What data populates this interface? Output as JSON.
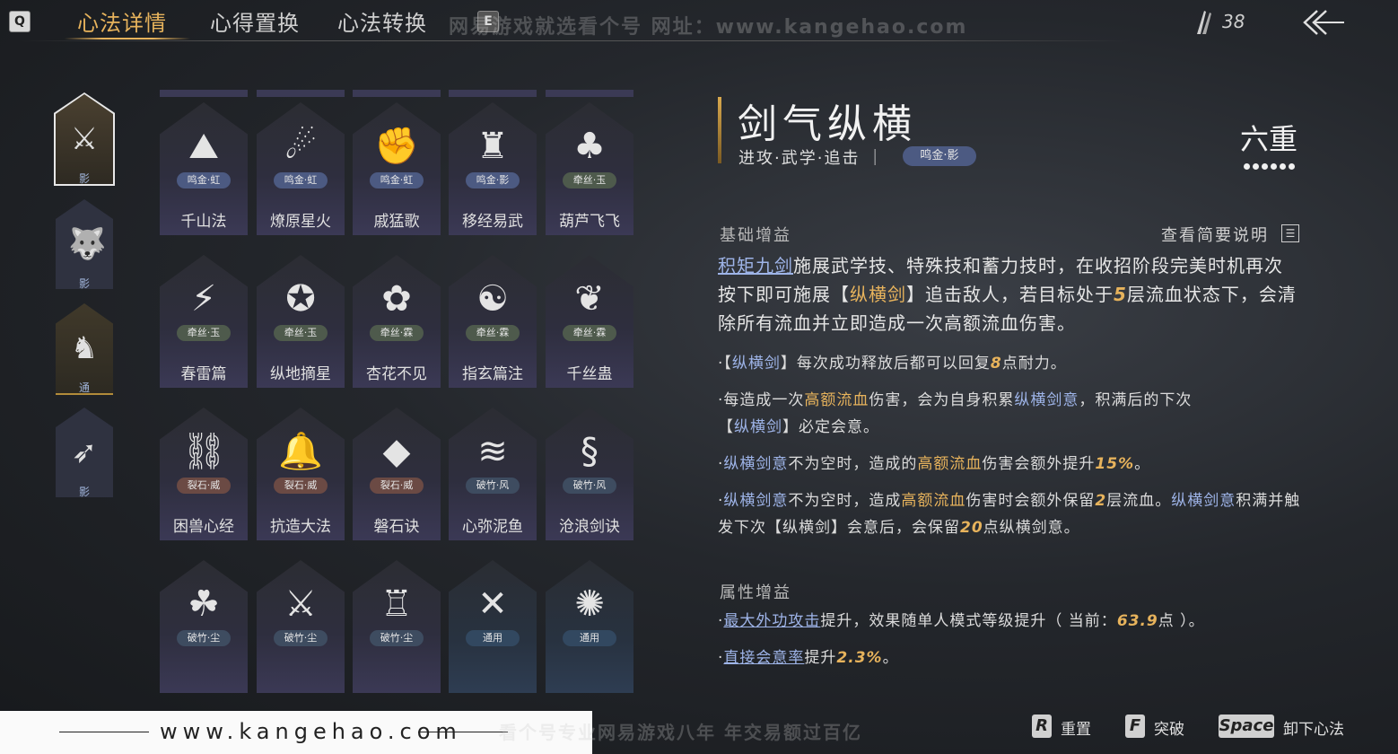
{
  "top": {
    "q_key": "Q",
    "tabs": [
      "心法详情",
      "心得置换",
      "心法转换"
    ],
    "e_key": "E",
    "watermark": "网易游戏就选看个号  网址：www.kangehao.com",
    "resource_count": "38",
    "icons": [
      "feather-icon",
      "back-arrow-icon"
    ]
  },
  "side_tabs": [
    {
      "icon": "sword-slash-icon",
      "label": "影"
    },
    {
      "icon": "wolf-icon",
      "label": "影"
    },
    {
      "icon": "horse-icon",
      "label": "通"
    },
    {
      "icon": "bow-icon",
      "label": "影"
    }
  ],
  "cards": [
    {
      "name": "千山法",
      "badge": "鸣金·虹",
      "kind": "jin",
      "icon": "mountain-icon",
      "glyph": "⛰"
    },
    {
      "name": "燎原星火",
      "badge": "鸣金·虹",
      "kind": "jin",
      "icon": "scythe-icon",
      "glyph": "☄"
    },
    {
      "name": "戚猛歌",
      "badge": "鸣金·虹",
      "kind": "jin",
      "icon": "fist-icon",
      "glyph": "✊"
    },
    {
      "name": "移经易武",
      "badge": "鸣金·影",
      "kind": "jin",
      "icon": "armor-icon",
      "glyph": "♜"
    },
    {
      "name": "葫芦飞飞",
      "badge": "牵丝·玉",
      "kind": "qian",
      "icon": "gourd-icon",
      "glyph": "♣"
    },
    {
      "name": "春雷篇",
      "badge": "牵丝·玉",
      "kind": "qian",
      "icon": "thunder-tree-icon",
      "glyph": "⚡"
    },
    {
      "name": "纵地摘星",
      "badge": "牵丝·玉",
      "kind": "qian",
      "icon": "star-orb-icon",
      "glyph": "✪"
    },
    {
      "name": "杏花不见",
      "badge": "牵丝·霖",
      "kind": "qian",
      "icon": "flower-icon",
      "glyph": "✿"
    },
    {
      "name": "指玄篇注",
      "badge": "牵丝·霖",
      "kind": "qian",
      "icon": "yin-yang-icon",
      "glyph": "☯"
    },
    {
      "name": "千丝蛊",
      "badge": "牵丝·霖",
      "kind": "qian",
      "icon": "leaf-icon",
      "glyph": "❦"
    },
    {
      "name": "困兽心经",
      "badge": "裂石·威",
      "kind": "lie",
      "icon": "collar-icon",
      "glyph": "⛓"
    },
    {
      "name": "抗造大法",
      "badge": "裂石·威",
      "kind": "lie",
      "icon": "bell-icon",
      "glyph": "🔔"
    },
    {
      "name": "磐石诀",
      "badge": "裂石·威",
      "kind": "lie",
      "icon": "rock-icon",
      "glyph": "◆"
    },
    {
      "name": "心弥泥鱼",
      "badge": "破竹·风",
      "kind": "jian",
      "icon": "fish-icon",
      "glyph": "≋"
    },
    {
      "name": "沧浪剑诀",
      "badge": "破竹·风",
      "kind": "jian",
      "icon": "dragon-icon",
      "glyph": "§"
    },
    {
      "name": "",
      "badge": "破竹·尘",
      "kind": "jian",
      "icon": "roots-icon",
      "glyph": "☘"
    },
    {
      "name": "",
      "badge": "破竹·尘",
      "kind": "jian",
      "icon": "dagger-icon",
      "glyph": "⚔"
    },
    {
      "name": "",
      "badge": "破竹·尘",
      "kind": "jian",
      "icon": "fortress-icon",
      "glyph": "♖"
    },
    {
      "name": "",
      "badge": "通用",
      "kind": "tong",
      "icon": "cross-blades-icon",
      "glyph": "✕"
    },
    {
      "name": "",
      "badge": "通用",
      "kind": "tong",
      "icon": "swirl-icon",
      "glyph": "✺"
    }
  ],
  "detail": {
    "title": "剑气纵横",
    "tags": "进攻·武学·追击",
    "badge": "鸣金·影",
    "level": "六重",
    "base_title": "基础增益",
    "summary_link": "查看简要说明",
    "main_p1_link": "积矩九剑",
    "main_p1_a": "施展武学技、特殊技和蓄力技时，在收招阶段完美时机再次按下即可施展【",
    "main_p1_b": "纵横剑",
    "main_p1_c": "】追击敌人，若目标处于",
    "main_p1_d": "5",
    "main_p1_e": "层流血状态下，会清除所有流血并立即造成一次高额流血伤害。",
    "b1_a": "·【",
    "b1_b": "纵横剑",
    "b1_c": "】每次成功释放后都可以回复",
    "b1_d": "8",
    "b1_e": "点耐力。",
    "b2_a": "·每造成一次",
    "b2_b": "高额流血",
    "b2_c": "伤害，会为自身积累",
    "b2_d": "纵横剑意",
    "b2_e": "，积满后的下次",
    "b2_f": "【",
    "b2_g": "纵横剑",
    "b2_h": "】必定会意。",
    "b3_a": "·",
    "b3_b": "纵横剑意",
    "b3_c": "不为空时，造成的",
    "b3_d": "高额流血",
    "b3_e": "伤害会额外提升",
    "b3_f": "15%",
    "b3_g": "。",
    "b4_a": "·",
    "b4_b": "纵横剑意",
    "b4_c": "不为空时，造成",
    "b4_d": "高额流血",
    "b4_e": "伤害时会额外保留",
    "b4_f": "2",
    "b4_g": "层流血。",
    "b4_h": "纵横剑意",
    "b4_i": "积满并触发下次【纵横剑】会意后，会保留",
    "b4_j": "20",
    "b4_k": "点纵横剑意。",
    "attr_title": "属性增益",
    "a1_a": "·",
    "a1_b": "最大外功攻击",
    "a1_c": "提升，效果随单人模式等级提升（ 当前：",
    "a1_d": "63.9",
    "a1_e": "点 ）。",
    "a2_a": "·",
    "a2_b": "直接会意率",
    "a2_c": "提升",
    "a2_d": "2.3%",
    "a2_e": "。"
  },
  "footer": {
    "url": "www.kangehao.com",
    "watermark": "看个号专业网易游戏八年  年交易额过百亿",
    "hints": [
      {
        "key": "R",
        "label": "重置"
      },
      {
        "key": "F",
        "label": "突破"
      },
      {
        "key": "Space",
        "label": "卸下心法"
      }
    ]
  }
}
